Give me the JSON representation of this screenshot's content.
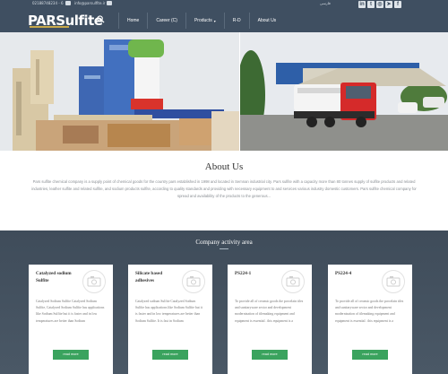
{
  "header": {
    "phone": "02188748234 - 6",
    "email": "info@parsulfite.ir",
    "language": "فارسی",
    "socials": [
      {
        "icon": "linkedin-icon",
        "glyph": "in"
      },
      {
        "icon": "twitter-icon",
        "glyph": "t"
      },
      {
        "icon": "instagram-icon",
        "glyph": "◎"
      },
      {
        "icon": "telegram-icon",
        "glyph": "➤"
      },
      {
        "icon": "facebook-icon",
        "glyph": "f"
      }
    ],
    "logo_part1": "PAR",
    "logo_part2": "Sulfite",
    "nav": {
      "home": "Home",
      "career": "Career (C)",
      "products": "Products",
      "rd": "R-D",
      "about": "About Us"
    }
  },
  "about": {
    "title": "About Us",
    "text": "Pars sulfite chemical company is a supply point of chemical goods for the country pars established in 1998 and located in Semnan industrial city. Pars sulfite with a capacity more than 80 tonnes supply of sulfite products and related industries, leather sulfite and related sulfite, and sodium products sulfite, according to quality standards and providing with necessary equipment to and services various industry domestic customers. Pars sulfite chemical company for spread and availability of the products to the generous..."
  },
  "activity": {
    "title": "Company activity area",
    "cards": [
      {
        "title": "Catalyzed sodium Sulfite",
        "text": "Catalyzed Sodium Sulfite Catalyzed Sodium Sulfite, Catalyzed Sodium Sulfite has applications like Sodium Sulfite but it is faster and in low temperatures are better than Sodium",
        "button": "read more"
      },
      {
        "title": "Silicate based adhesives",
        "text": "Catalyzed sodium Sulfite Catalyzed Sodium Sulfite has applications like Sodium Sulfite but it is faster and in low temperatures are better than Sodium Sulfite. It is fast in Sodium",
        "button": "read more"
      },
      {
        "title": "PS224-1",
        "text": "To provide all of ceramic goods the porcelain tiles and sanitaryware sector and development modernization of tilemaking equipment and equipment is essential . this equipment is a",
        "button": "read more"
      },
      {
        "title": "PS224-4",
        "text": "To provide all of ceramic goods the porcelain tiles and sanitaryware sector and development modernization of tilemaking equipment and equipment is essential . this equipment is a",
        "button": "read more"
      }
    ]
  },
  "colors": {
    "header_bg": "#3f4f61",
    "activity_bg": "#44525f",
    "button": "#3aa35e"
  }
}
